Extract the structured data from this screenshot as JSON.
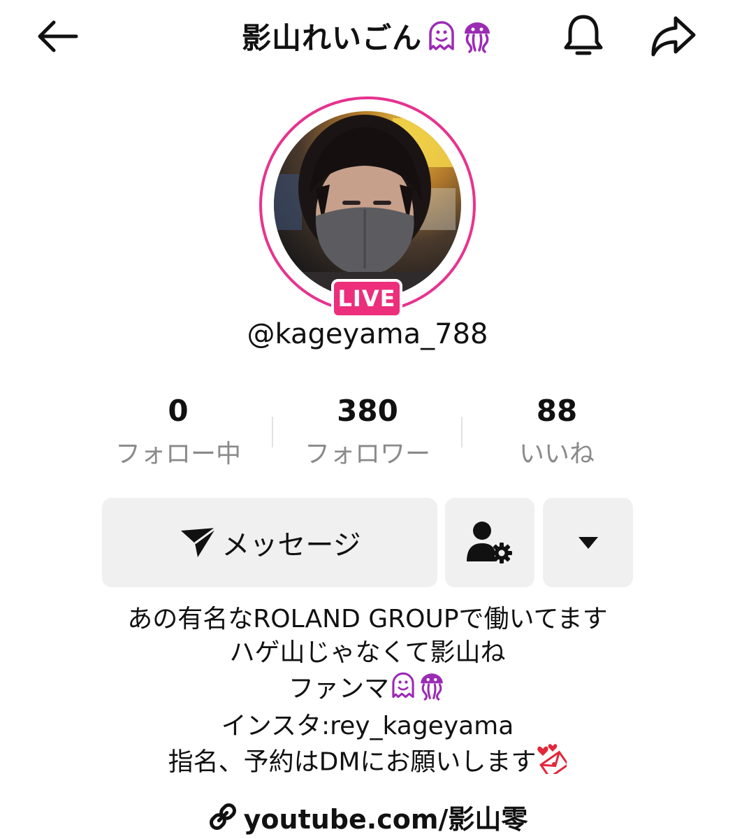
{
  "header": {
    "title": "影山れいごん",
    "title_emojis": [
      "ghost-emoji",
      "jellyfish-emoji"
    ]
  },
  "profile": {
    "live_badge": "LIVE",
    "handle": "@kageyama_788"
  },
  "stats": [
    {
      "value": "0",
      "label": "フォロー中"
    },
    {
      "value": "380",
      "label": "フォロワー"
    },
    {
      "value": "88",
      "label": "いいね"
    }
  ],
  "actions": {
    "message_label": "メッセージ"
  },
  "bio": {
    "line1": "あの有名なROLAND GROUPで働いてます",
    "line2": "ハゲ山じゃなくて影山ね",
    "line3": "ファンマ",
    "line4": "インスタ:rey_kageyama",
    "line5": "指名、予約はDMにお願いします"
  },
  "link": {
    "text": "youtube.com/影山零"
  },
  "colors": {
    "accent": "#ec2e7b",
    "ring": "#e7338f",
    "emoji_purple": "#9b2bb5",
    "muted_text": "#8a8a8a",
    "button_bg": "#f0f0f0"
  }
}
